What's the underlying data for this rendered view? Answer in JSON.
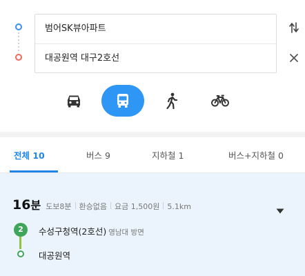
{
  "search": {
    "origin_value": "범어SK뷰아파트",
    "destination_value": "대공원역 대구2호선",
    "swap_icon": "swap-vertical-icon",
    "clear_icon": "close-icon"
  },
  "modes": [
    {
      "name": "car",
      "icon": "car-icon",
      "selected": false
    },
    {
      "name": "bus",
      "icon": "bus-icon",
      "selected": true
    },
    {
      "name": "walk",
      "icon": "walk-icon",
      "selected": false
    },
    {
      "name": "bicycle",
      "icon": "bicycle-icon",
      "selected": false
    }
  ],
  "tabs": [
    {
      "label": "전체 10",
      "active": true
    },
    {
      "label": "버스 9",
      "active": false
    },
    {
      "label": "지하철 1",
      "active": false
    },
    {
      "label": "버스+지하철 0",
      "active": false
    }
  ],
  "route": {
    "duration": "16",
    "duration_unit": "분",
    "walk": "도보8분",
    "transfers": "환승없음",
    "fare": "요금 1,500원",
    "distance": "5.1km",
    "line_number": "2",
    "board_station": "수성구청역(2호선)",
    "direction": "영남대 방면",
    "alight_station": "대공원역"
  },
  "colors": {
    "accent": "#2e96f5",
    "active_tab": "#1f86e8",
    "origin_dot": "#3a8ef6",
    "destination_dot": "#f0695a",
    "line2": "#3ea55a",
    "result_background": "#ebf4fd"
  }
}
